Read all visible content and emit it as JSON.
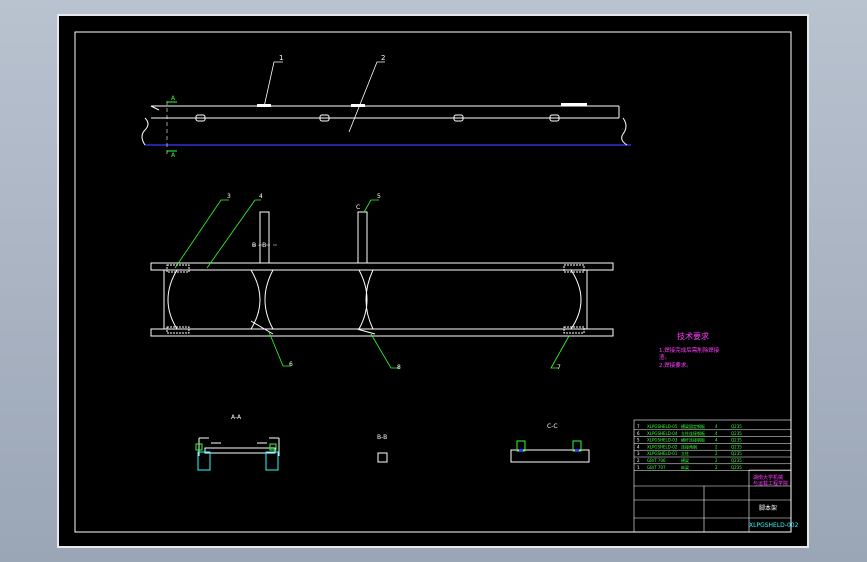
{
  "drawing": {
    "part_labels": {
      "top1": "1",
      "top2": "2",
      "sec_a_top": "A",
      "sec_a_bot": "A",
      "plan_3": "3",
      "plan_4": "4",
      "plan_5": "5",
      "plan_b": "B - B",
      "plan_c": "C",
      "plan_6": "6",
      "plan_8": "8",
      "plan_7": "7"
    },
    "section_titles": {
      "aa": "A-A",
      "bb": "B-B",
      "cc": "C-C"
    },
    "tech_requirements": {
      "title": "技术要求",
      "line1": "1.焊接完成后需削除焊接",
      "line1b": "渣。",
      "line2": "2.焊接要求。"
    },
    "title_block": {
      "drawing_name": "脚本架",
      "drawing_number": "XLPGSHELD-002",
      "company_line1": "湖南大学机械",
      "company_line2": "与运载工程学院",
      "bom_rows": [
        [
          "7",
          "XLPGSHELD-05",
          "横梁固定钢板",
          "4",
          "Q235"
        ],
        [
          "6",
          "XLPGSHELD-04",
          "立柱连接钢板",
          "4",
          "Q235"
        ],
        [
          "5",
          "XLPGSHELD-03",
          "横杆连接钢板",
          "4",
          "Q235"
        ],
        [
          "4",
          "XLPGSHELD-02",
          "连接角钢",
          "2",
          "Q235"
        ],
        [
          "3",
          "XLPGSHELD-01",
          "立柱",
          "2",
          "Q235"
        ],
        [
          "2",
          "GB/T 706",
          "横梁",
          "2",
          "Q235"
        ],
        [
          "1",
          "GB/T 707",
          "纵梁",
          "2",
          "Q235"
        ]
      ]
    }
  }
}
